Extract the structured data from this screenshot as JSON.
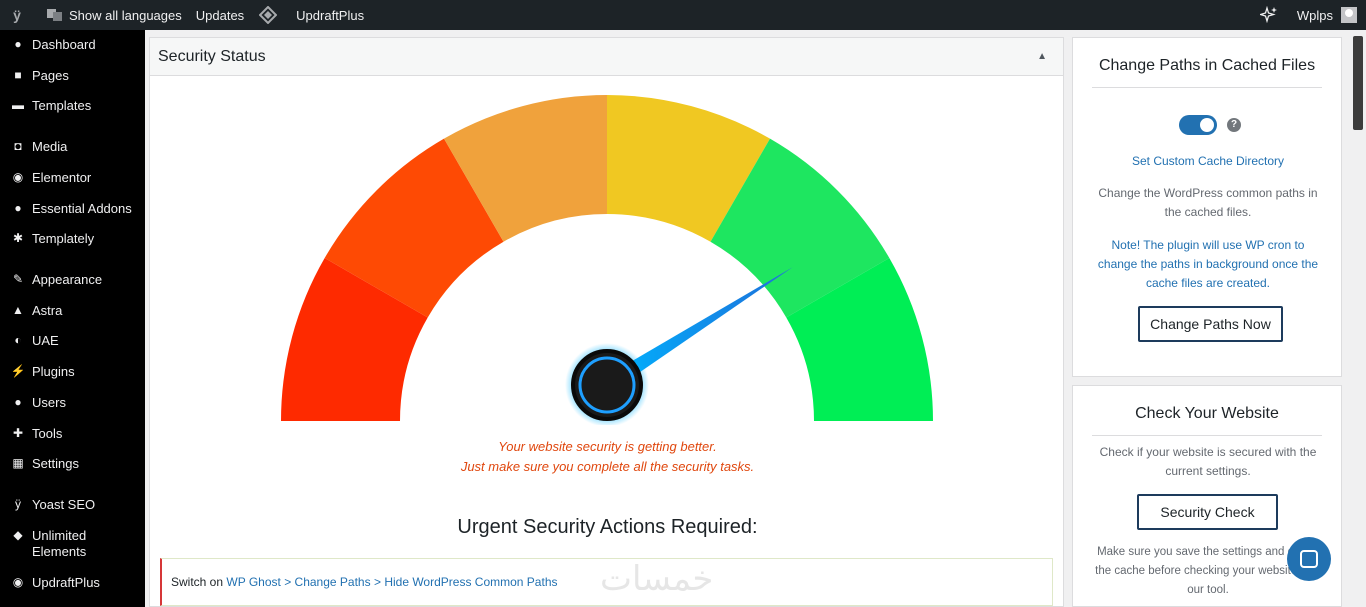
{
  "adminbar": {
    "wp_logo_icon": "yoast-logo-icon",
    "language_icon": "translate-icon",
    "language_label": "Show all languages",
    "updates_label": "Updates",
    "updraft_icon": "updraft-diamond-icon",
    "updraft_label": "UpdraftPlus",
    "ai_icon": "sparkle-icon",
    "user_label": "Wplps"
  },
  "sidebar": {
    "items": [
      {
        "label": "Dashboard",
        "icon": "dashboard-icon"
      },
      {
        "label": "Pages",
        "icon": "pages-icon"
      },
      {
        "label": "Templates",
        "icon": "folder-icon"
      },
      {
        "label": "Media",
        "icon": "media-icon"
      },
      {
        "label": "Elementor",
        "icon": "elementor-icon"
      },
      {
        "label": "Essential Addons",
        "icon": "essential-addons-icon"
      },
      {
        "label": "Templately",
        "icon": "templately-icon"
      },
      {
        "label": "Appearance",
        "icon": "appearance-icon"
      },
      {
        "label": "Astra",
        "icon": "astra-icon"
      },
      {
        "label": "UAE",
        "icon": "uae-icon"
      },
      {
        "label": "Plugins",
        "icon": "plugins-icon"
      },
      {
        "label": "Users",
        "icon": "users-icon"
      },
      {
        "label": "Tools",
        "icon": "tools-icon"
      },
      {
        "label": "Settings",
        "icon": "settings-icon"
      },
      {
        "label": "Yoast SEO",
        "icon": "yoast-icon"
      },
      {
        "label": "Unlimited Elements",
        "icon": "unlimited-elements-icon"
      },
      {
        "label": "UpdraftPlus",
        "icon": "updraftplus-icon"
      }
    ]
  },
  "main": {
    "title": "Security Status",
    "gauge": {
      "level": 0.82,
      "segment_colors": [
        "#fe2a00",
        "#fe4a04",
        "#f0a23c",
        "#f0c822",
        "#1ee660",
        "#00ee55"
      ]
    },
    "status_line1": "Your website security is getting better.",
    "status_line2": "Just make sure you complete all the security tasks.",
    "urgent_title": "Urgent Security Actions Required:",
    "task": {
      "prefix": "Switch on",
      "link1": "WP Ghost",
      "sep1": ">",
      "link2": "Change Paths",
      "sep2": ">",
      "link3": "Hide WordPress Common Paths"
    },
    "watermark": "خمسات"
  },
  "card_paths": {
    "title": "Change Paths in Cached Files",
    "toggle_on": true,
    "help_glyph": "?",
    "link": "Set Custom Cache Directory",
    "description": "Change the WordPress common paths in the cached files.",
    "note": "Note! The plugin will use WP cron to change the paths in background once the cache files are created.",
    "button": "Change Paths Now"
  },
  "card_check": {
    "title": "Check Your Website",
    "description": "Check if your website is secured with the current settings.",
    "button": "Security Check",
    "footer": "Make sure you save the settings and empty the cache before checking your website with our tool."
  },
  "colors": {
    "sidebar_bg": "#000000",
    "adminbar_bg": "#1d2327",
    "accent": "#2271b1",
    "warning_text": "#e0470e"
  }
}
